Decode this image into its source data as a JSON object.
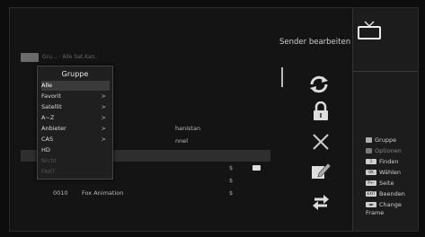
{
  "header": {
    "title": "Sender bearbeiten",
    "breadcrumb": "Gru... · Alle Sat.Kan.."
  },
  "group_menu": {
    "title": "Gruppe",
    "items": [
      {
        "label": "Alle",
        "chevron": ""
      },
      {
        "label": "Favorit",
        "chevron": ">"
      },
      {
        "label": "Satellit",
        "chevron": ">"
      },
      {
        "label": "A~Z",
        "chevron": ">"
      },
      {
        "label": "Anbieter",
        "chevron": ">"
      },
      {
        "label": "CAS",
        "chevron": ">"
      },
      {
        "label": "HD",
        "chevron": ""
      },
      {
        "label": "Nicht",
        "chevron": ""
      },
      {
        "label": "FAKT",
        "chevron": ""
      }
    ]
  },
  "channel_list": [
    {
      "num": "",
      "name": "hanistan",
      "dollar": "",
      "hd": false
    },
    {
      "num": "",
      "name": "nnel",
      "dollar": "",
      "hd": false
    },
    {
      "num": "",
      "name": "",
      "dollar": "",
      "hd": false
    },
    {
      "num": "",
      "name": "",
      "dollar": "$",
      "hd": true
    },
    {
      "num": "",
      "name": "",
      "dollar": "$",
      "hd": false
    },
    {
      "num": "0010",
      "name": "Fox Animation",
      "dollar": "$",
      "hd": false
    }
  ],
  "tools": [
    "move-icon",
    "lock-icon",
    "delete-icon",
    "rename-icon",
    "sort-icon"
  ],
  "legend": [
    {
      "label": "Gruppe",
      "key": "",
      "color": "#b0b0b0"
    },
    {
      "label": "Optionen",
      "key": "",
      "color": "#7a7a7a"
    },
    {
      "label": "Finden",
      "key": "1",
      "color": ""
    },
    {
      "label": "Wählen",
      "key": "OK",
      "color": ""
    },
    {
      "label": "Seite",
      "key": "P+-",
      "color": ""
    },
    {
      "label": "Beenden",
      "key": "EXIT",
      "color": ""
    },
    {
      "label": "Change Frame",
      "key": "◄►",
      "color": ""
    }
  ],
  "colors": {
    "bg": "#141414",
    "panel": "#1c1c1c",
    "highlight": "#2e2e2e"
  }
}
